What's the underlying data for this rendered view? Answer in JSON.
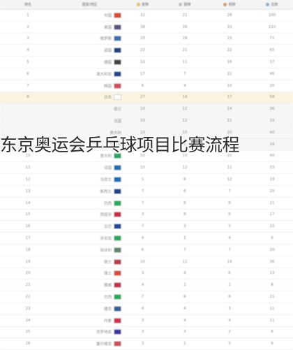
{
  "table": {
    "headers": [
      {
        "label": "排名",
        "icon": ""
      },
      {
        "label": "国家/地区",
        "icon": ""
      },
      {
        "label": "金牌",
        "icon": "gold"
      },
      {
        "label": "银牌",
        "icon": "silver"
      },
      {
        "label": "铜牌",
        "icon": "bronze"
      },
      {
        "label": "总数",
        "icon": "total"
      }
    ],
    "rows": [
      {
        "rank": "1",
        "country": "中国",
        "flag": "#de2910",
        "gold": "32",
        "silver": "21",
        "bronze": "28",
        "total": "100",
        "style": ""
      },
      {
        "rank": "2",
        "country": "美国",
        "flag": "#3c3b6e",
        "gold": "38",
        "silver": "39",
        "bronze": "33",
        "total": "110",
        "style": ""
      },
      {
        "rank": "3",
        "country": "俄罗斯",
        "flag": "#1c57a5",
        "gold": "20",
        "silver": "28",
        "bronze": "23",
        "total": "71",
        "style": ""
      },
      {
        "rank": "4",
        "country": "英国",
        "flag": "#012169",
        "gold": "22",
        "silver": "21",
        "bronze": "22",
        "total": "65",
        "style": ""
      },
      {
        "rank": "5",
        "country": "德国",
        "flag": "#222222",
        "gold": "10",
        "silver": "11",
        "bronze": "16",
        "total": "37",
        "style": ""
      },
      {
        "rank": "6",
        "country": "澳大利亚",
        "flag": "#00247d",
        "gold": "17",
        "silver": "7",
        "bronze": "22",
        "total": "46",
        "style": ""
      },
      {
        "rank": "7",
        "country": "韩国",
        "flag": "#cd2e3a",
        "gold": "6",
        "silver": "4",
        "bronze": "10",
        "total": "20",
        "style": ""
      },
      {
        "rank": "8",
        "country": "日本",
        "flag": "#ffffff",
        "gold": "27",
        "silver": "14",
        "bronze": "17",
        "total": "58",
        "style": "hl"
      },
      {
        "rank": "",
        "country": "荷兰",
        "flag": "",
        "gold": "10",
        "silver": "12",
        "bronze": "14",
        "total": "36",
        "style": "sub"
      },
      {
        "rank": "",
        "country": "法国",
        "flag": "",
        "gold": "10",
        "silver": "12",
        "bronze": "11",
        "total": "33",
        "style": "sub"
      },
      {
        "rank": "",
        "country": "意大利",
        "flag": "",
        "gold": "10",
        "silver": "10",
        "bronze": "20",
        "total": "40",
        "style": "sub"
      },
      {
        "rank": "",
        "country": "加拿大",
        "flag": "",
        "gold": "7",
        "silver": "6",
        "bronze": "11",
        "total": "24",
        "style": "sub"
      },
      {
        "rank": "10",
        "country": "意大利",
        "flag": "#009246",
        "gold": "10",
        "silver": "10",
        "bronze": "20",
        "total": "40",
        "style": ""
      },
      {
        "rank": "11",
        "country": "法国",
        "flag": "#0055a4",
        "gold": "10",
        "silver": "12",
        "bronze": "11",
        "total": "33",
        "style": ""
      },
      {
        "rank": "12",
        "country": "乌克兰",
        "flag": "#0057b7",
        "gold": "1",
        "silver": "6",
        "bronze": "12",
        "total": "19",
        "style": ""
      },
      {
        "rank": "13",
        "country": "新西兰",
        "flag": "#00247d",
        "gold": "7",
        "silver": "6",
        "bronze": "7",
        "total": "20",
        "style": ""
      },
      {
        "rank": "14",
        "country": "巴西",
        "flag": "#009c3b",
        "gold": "7",
        "silver": "6",
        "bronze": "8",
        "total": "21",
        "style": ""
      },
      {
        "rank": "15",
        "country": "西班牙",
        "flag": "#c60b1e",
        "gold": "3",
        "silver": "8",
        "bronze": "6",
        "total": "17",
        "style": ""
      },
      {
        "rank": "16",
        "country": "古巴",
        "flag": "#002a8f",
        "gold": "7",
        "silver": "3",
        "bronze": "5",
        "total": "15",
        "style": ""
      },
      {
        "rank": "17",
        "country": "牙买加",
        "flag": "#009b3a",
        "gold": "4",
        "silver": "1",
        "bronze": "4",
        "total": "9",
        "style": ""
      },
      {
        "rank": "18",
        "country": "匈牙利",
        "flag": "#477050",
        "gold": "6",
        "silver": "7",
        "bronze": "7",
        "total": "20",
        "style": ""
      },
      {
        "rank": "19",
        "country": "荷兰",
        "flag": "#ae1c28",
        "gold": "10",
        "silver": "12",
        "bronze": "14",
        "total": "36",
        "style": ""
      },
      {
        "rank": "20",
        "country": "瑞士",
        "flag": "#d52b1e",
        "gold": "3",
        "silver": "4",
        "bronze": "6",
        "total": "13",
        "style": ""
      },
      {
        "rank": "21",
        "country": "挪威",
        "flag": "#ba0c2f",
        "gold": "4",
        "silver": "2",
        "bronze": "2",
        "total": "8",
        "style": ""
      },
      {
        "rank": "22",
        "country": "巴西",
        "flag": "#009c3b",
        "gold": "7",
        "silver": "6",
        "bronze": "8",
        "total": "21",
        "style": ""
      },
      {
        "rank": "23",
        "country": "捷克",
        "flag": "#11457e",
        "gold": "4",
        "silver": "4",
        "bronze": "3",
        "total": "11",
        "style": ""
      },
      {
        "rank": "24",
        "country": "丹麦",
        "flag": "#c8102e",
        "gold": "3",
        "silver": "4",
        "bronze": "4",
        "total": "11",
        "style": ""
      },
      {
        "rank": "25",
        "country": "克罗地亚",
        "flag": "#171796",
        "gold": "3",
        "silver": "3",
        "bronze": "2",
        "total": "8",
        "style": ""
      },
      {
        "rank": "26",
        "country": "塞尔维亚",
        "flag": "#c6363c",
        "gold": "3",
        "silver": "1",
        "bronze": "5",
        "total": "9",
        "style": ""
      }
    ]
  },
  "overlay": {
    "title": "东京奥运会乒乓球项目比赛流程"
  }
}
